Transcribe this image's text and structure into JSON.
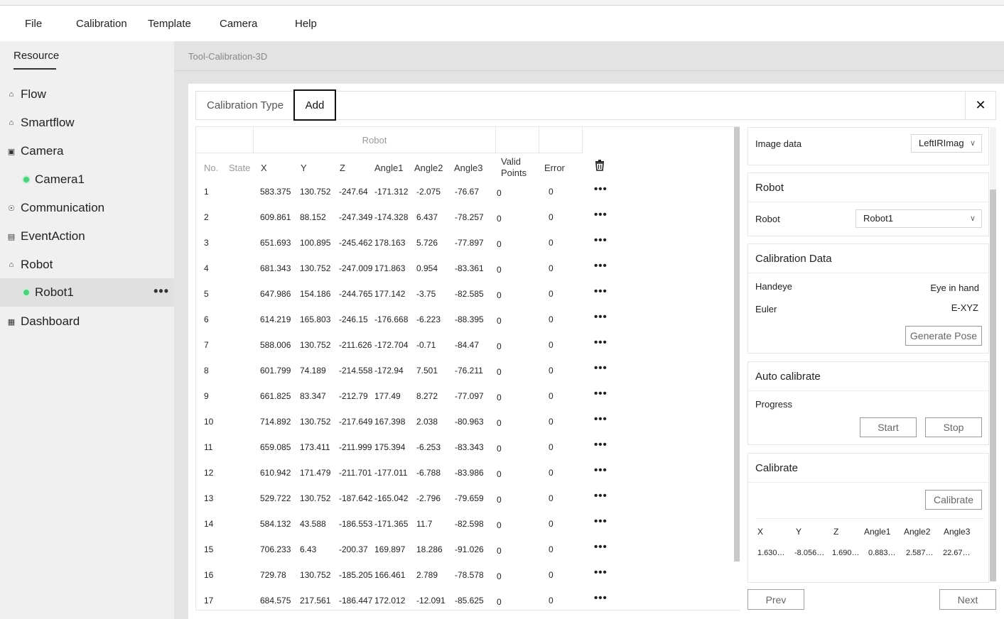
{
  "menu": [
    "File",
    "Calibration",
    "Template",
    "Camera",
    "Help"
  ],
  "sidebar": {
    "tab": "Resource",
    "items": [
      {
        "label": "Flow",
        "icon": "flow-icon"
      },
      {
        "label": "Smartflow",
        "icon": "smartflow-icon"
      },
      {
        "label": "Camera",
        "icon": "camera-icon"
      },
      {
        "label": "Camera1",
        "icon": "status-dot"
      },
      {
        "label": "Communication",
        "icon": "communication-icon"
      },
      {
        "label": "EventAction",
        "icon": "event-icon"
      },
      {
        "label": "Robot",
        "icon": "robot-icon"
      },
      {
        "label": "Robot1",
        "icon": "status-dot"
      },
      {
        "label": "Dashboard",
        "icon": "dashboard-icon"
      }
    ],
    "selected": "Robot1"
  },
  "page_title": "Tool-Calibration-3D",
  "dialog": {
    "tab1": "Calibration Type",
    "tab2": "Add",
    "close": "✕"
  },
  "table": {
    "group": "Robot",
    "headers": [
      "No.",
      "State",
      "X",
      "Y",
      "Z",
      "Angle1",
      "Angle2",
      "Angle3",
      "Valid Points",
      "Error"
    ],
    "rows": [
      [
        "1",
        "",
        "583.375",
        "130.752",
        "-247.64",
        "-171.312",
        "-2.075",
        "-76.67",
        "0",
        "0"
      ],
      [
        "2",
        "",
        "609.861",
        "88.152",
        "-247.349",
        "-174.328",
        "6.437",
        "-78.257",
        "0",
        "0"
      ],
      [
        "3",
        "",
        "651.693",
        "100.895",
        "-245.462",
        "178.163",
        "5.726",
        "-77.897",
        "0",
        "0"
      ],
      [
        "4",
        "",
        "681.343",
        "130.752",
        "-247.009",
        "171.863",
        "0.954",
        "-83.361",
        "0",
        "0"
      ],
      [
        "5",
        "",
        "647.986",
        "154.186",
        "-244.765",
        "177.142",
        "-3.75",
        "-82.585",
        "0",
        "0"
      ],
      [
        "6",
        "",
        "614.219",
        "165.803",
        "-246.15",
        "-176.668",
        "-6.223",
        "-88.395",
        "0",
        "0"
      ],
      [
        "7",
        "",
        "588.006",
        "130.752",
        "-211.626",
        "-172.704",
        "-0.71",
        "-84.47",
        "0",
        "0"
      ],
      [
        "8",
        "",
        "601.799",
        "74.189",
        "-214.558",
        "-172.94",
        "7.501",
        "-76.211",
        "0",
        "0"
      ],
      [
        "9",
        "",
        "661.825",
        "83.347",
        "-212.79",
        "177.49",
        "8.272",
        "-77.097",
        "0",
        "0"
      ],
      [
        "10",
        "",
        "714.892",
        "130.752",
        "-217.649",
        "167.398",
        "2.038",
        "-80.963",
        "0",
        "0"
      ],
      [
        "11",
        "",
        "659.085",
        "173.411",
        "-211.999",
        "175.394",
        "-6.253",
        "-83.343",
        "0",
        "0"
      ],
      [
        "12",
        "",
        "610.942",
        "171.479",
        "-211.701",
        "-177.011",
        "-6.788",
        "-83.986",
        "0",
        "0"
      ],
      [
        "13",
        "",
        "529.722",
        "130.752",
        "-187.642",
        "-165.042",
        "-2.796",
        "-79.659",
        "0",
        "0"
      ],
      [
        "14",
        "",
        "584.132",
        "43.588",
        "-186.553",
        "-171.365",
        "11.7",
        "-82.598",
        "0",
        "0"
      ],
      [
        "15",
        "",
        "706.233",
        "6.43",
        "-200.37",
        "169.897",
        "18.286",
        "-91.026",
        "0",
        "0"
      ],
      [
        "16",
        "",
        "729.78",
        "130.752",
        "-185.205",
        "166.461",
        "2.789",
        "-78.578",
        "0",
        "0"
      ],
      [
        "17",
        "",
        "684.575",
        "217.561",
        "-186.447",
        "172.012",
        "-12.091",
        "-85.625",
        "0",
        "0"
      ]
    ]
  },
  "right_panel": {
    "image_data_label": "Image data",
    "image_data_value": "LeftIRImag",
    "robot_title": "Robot",
    "robot_label": "Robot",
    "robot_value": "Robot1",
    "calib_data_title": "Calibration Data",
    "handeye_label": "Handeye",
    "handeye_value": "Eye in hand",
    "euler_label": "Euler",
    "euler_value": "E-XYZ",
    "generate_pose": "Generate Pose",
    "auto_title": "Auto calibrate",
    "progress_label": "Progress",
    "start": "Start",
    "stop": "Stop",
    "calibrate_title": "Calibrate",
    "calibrate_btn": "Calibrate",
    "result_headers": [
      "X",
      "Y",
      "Z",
      "Angle1",
      "Angle2",
      "Angle3"
    ],
    "result_values": [
      "1.630…",
      "-8.056…",
      "1.690…",
      "0.883…",
      "2.587…",
      "22.67…"
    ]
  },
  "footer": {
    "prev": "Prev",
    "next": "Next"
  }
}
